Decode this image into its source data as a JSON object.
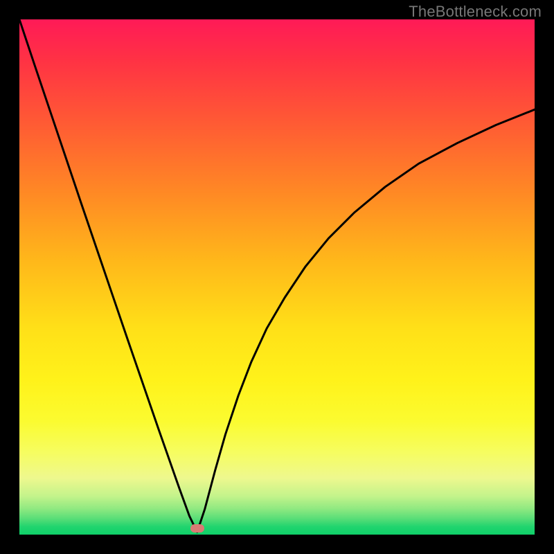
{
  "watermark": "TheBottleneck.com",
  "colors": {
    "frame_bg": "#000000",
    "marker": "#d97b74",
    "curve": "#000000"
  },
  "chart_data": {
    "type": "line",
    "title": "",
    "xlabel": "",
    "ylabel": "",
    "xlim": [
      0,
      100
    ],
    "ylim": [
      0,
      100
    ],
    "grid": false,
    "legend": false,
    "marker": {
      "x": 34.5,
      "y": 1.2
    },
    "series": [
      {
        "name": "bottleneck-curve",
        "x": [
          0,
          3,
          6,
          9,
          12,
          15,
          18,
          21,
          24,
          27,
          29,
          31,
          33,
          34.5,
          36,
          38,
          40,
          42.5,
          45,
          48,
          51.5,
          55.5,
          60,
          65,
          71,
          77.5,
          85,
          92.5,
          100
        ],
        "y": [
          100,
          91.0,
          82.1,
          73.2,
          64.3,
          55.5,
          46.7,
          37.9,
          29.2,
          20.5,
          14.8,
          9.1,
          3.6,
          0.5,
          5.0,
          12.5,
          19.5,
          27.0,
          33.5,
          40.0,
          46.0,
          52.0,
          57.5,
          62.5,
          67.5,
          72.0,
          76.0,
          79.5,
          82.5
        ]
      }
    ]
  }
}
